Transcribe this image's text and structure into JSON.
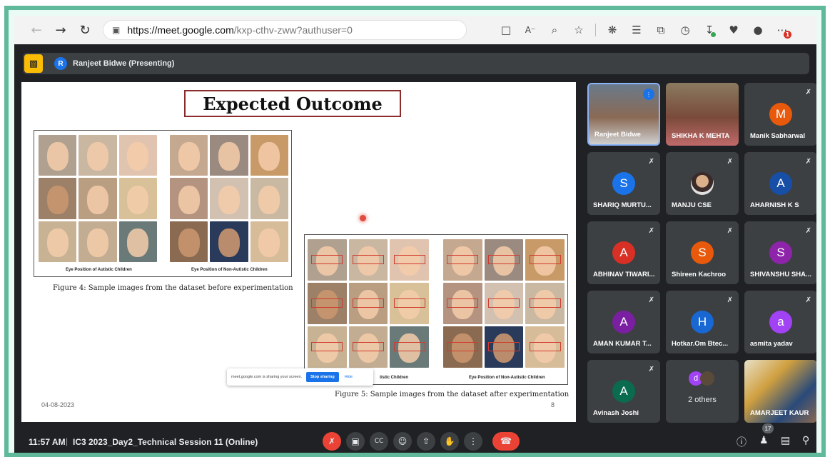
{
  "browser": {
    "url_host": "https://meet.google.com",
    "url_path": "/kxp-cthv-zww?authuser=0",
    "badge_count": "1"
  },
  "meet": {
    "presenter_initial": "R",
    "presenting_label": "Ranjeet Bidwe (Presenting)"
  },
  "slide": {
    "title": "Expected Outcome",
    "panel_left_caption_1": "Eye Position of Autistic Children",
    "panel_left_caption_2": "Eye Position of Non-Autistic Children",
    "figure4_caption": "Figure 4: Sample images from the dataset before experimentation",
    "panel_right_caption_1": "tistic Children",
    "panel_right_caption_2": "Eye Position of Non-Autistic Children",
    "figure5_caption": "Figure 5: Sample images from the dataset after experimentation",
    "date": "04-08-2023",
    "page_number": "8",
    "share_notice": "meet.google.com is sharing your screen.",
    "stop_sharing": "Stop sharing",
    "hide": "Hide"
  },
  "participants": [
    {
      "name": "Ranjeet Bidwe",
      "initial": "",
      "color": "#6b4a3a",
      "muted": false,
      "speaking": true,
      "video": true
    },
    {
      "name": "SHIKHA K MEHTA",
      "initial": "",
      "color": "#8a6a55",
      "muted": false,
      "speaking": false,
      "video": true
    },
    {
      "name": "Manik Sabharwal",
      "initial": "M",
      "color": "#e8590c",
      "muted": true
    },
    {
      "name": "SHARIQ MURTU...",
      "initial": "S",
      "color": "#1a73e8",
      "muted": true
    },
    {
      "name": "MANJU CSE",
      "initial": "",
      "color": "#c9a27a",
      "muted": true
    },
    {
      "name": "AHARNISH K S",
      "initial": "A",
      "color": "#174ea6",
      "muted": true
    },
    {
      "name": "ABHINAV TIWARI...",
      "initial": "A",
      "color": "#d93025",
      "muted": true
    },
    {
      "name": "Shireen Kachroo",
      "initial": "S",
      "color": "#e8590c",
      "muted": true
    },
    {
      "name": "SHIVANSHU SHA...",
      "initial": "S",
      "color": "#8e24aa",
      "muted": true
    },
    {
      "name": "AMAN KUMAR T...",
      "initial": "A",
      "color": "#7b1fa2",
      "muted": true
    },
    {
      "name": "Hotkar.Om Btec...",
      "initial": "H",
      "color": "#1967d2",
      "muted": true
    },
    {
      "name": "asmita yadav",
      "initial": "a",
      "color": "#a142f4",
      "muted": true
    },
    {
      "name": "Avinash Joshi",
      "initial": "A",
      "color": "#0b6b4f",
      "muted": true
    },
    {
      "name": "2 others",
      "initial": "d",
      "color": "#a142f4",
      "muted": false
    },
    {
      "name": "AMARJEET KAUR",
      "initial": "",
      "color": "#4a6a88",
      "muted": true,
      "video": true
    }
  ],
  "bottom": {
    "time": "11:57 AM",
    "separator": "|",
    "meeting_name": "IC3 2023_Day2_Technical Session 11 (Online)",
    "people_count": "17"
  },
  "icons": {
    "back": "arrow-left-icon",
    "forward": "arrow-right-icon",
    "reload": "reload-icon",
    "lock": "info-lock-icon",
    "mic_off": "mic-off-icon",
    "camera": "camera-icon",
    "captions": "captions-icon",
    "emoji": "emoji-icon",
    "present": "present-icon",
    "hand": "raise-hand-icon",
    "more": "more-options-icon",
    "end_call": "end-call-icon"
  },
  "colors": {
    "frame": "#5fb99a",
    "meet_bg": "#202124",
    "tile_bg": "#3c4043",
    "accent_blue": "#1a73e8",
    "end_red": "#ea4335",
    "present_yellow": "#fbbc04"
  }
}
